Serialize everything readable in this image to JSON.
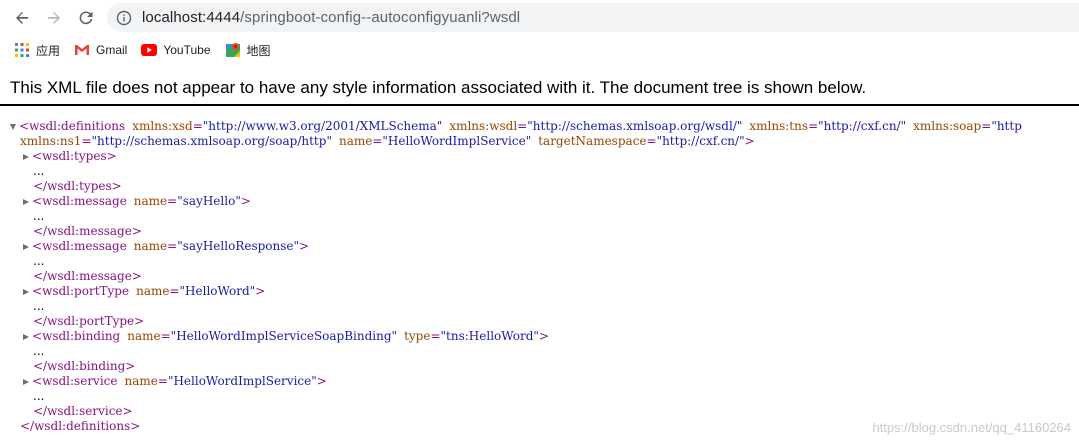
{
  "browser": {
    "url_host": "localhost:4444",
    "url_path": "/springboot-config--autoconfigyuanli?wsdl",
    "bookmarks": [
      {
        "label": "应用",
        "icon": "apps-grid-icon"
      },
      {
        "label": "Gmail",
        "icon": "gmail-icon"
      },
      {
        "label": "YouTube",
        "icon": "youtube-icon"
      },
      {
        "label": "地图",
        "icon": "maps-icon"
      }
    ]
  },
  "xml_viewer": {
    "banner": "This XML file does not appear to have any style information associated with it. The document tree is shown below.",
    "root_open_tag": "wsdl:definitions",
    "root_attrs_line1": [
      {
        "name": "xmlns:xsd",
        "value": "\"http://www.w3.org/2001/XMLSchema\""
      },
      {
        "name": "xmlns:wsdl",
        "value": "\"http://schemas.xmlsoap.org/wsdl/\""
      },
      {
        "name": "xmlns:tns",
        "value": "\"http://cxf.cn/\""
      },
      {
        "name": "xmlns:soap",
        "value": "\"http"
      }
    ],
    "root_attrs_line2": [
      {
        "name": "xmlns:ns1",
        "value": "\"http://schemas.xmlsoap.org/soap/http\""
      },
      {
        "name": "name",
        "value": "\"HelloWordImplService\""
      },
      {
        "name": "targetNamespace",
        "value": "\"http://cxf.cn/\""
      }
    ],
    "ellipsis": "...",
    "children": [
      {
        "tag": "wsdl:types",
        "attrs": []
      },
      {
        "tag": "wsdl:message",
        "attrs": [
          {
            "name": "name",
            "value": "\"sayHello\""
          }
        ]
      },
      {
        "tag": "wsdl:message",
        "attrs": [
          {
            "name": "name",
            "value": "\"sayHelloResponse\""
          }
        ]
      },
      {
        "tag": "wsdl:portType",
        "attrs": [
          {
            "name": "name",
            "value": "\"HelloWord\""
          }
        ]
      },
      {
        "tag": "wsdl:binding",
        "attrs": [
          {
            "name": "name",
            "value": "\"HelloWordImplServiceSoapBinding\""
          },
          {
            "name": "type",
            "value": "\"tns:HelloWord\""
          }
        ]
      },
      {
        "tag": "wsdl:service",
        "attrs": [
          {
            "name": "name",
            "value": "\"HelloWordImplService\""
          }
        ]
      }
    ],
    "root_close_tag": "wsdl:definitions"
  },
  "watermark": "https://blog.csdn.net/qq_41160264",
  "colors": {
    "tag": "#881280",
    "attr_name": "#994500",
    "attr_value": "#1a1aa6"
  }
}
